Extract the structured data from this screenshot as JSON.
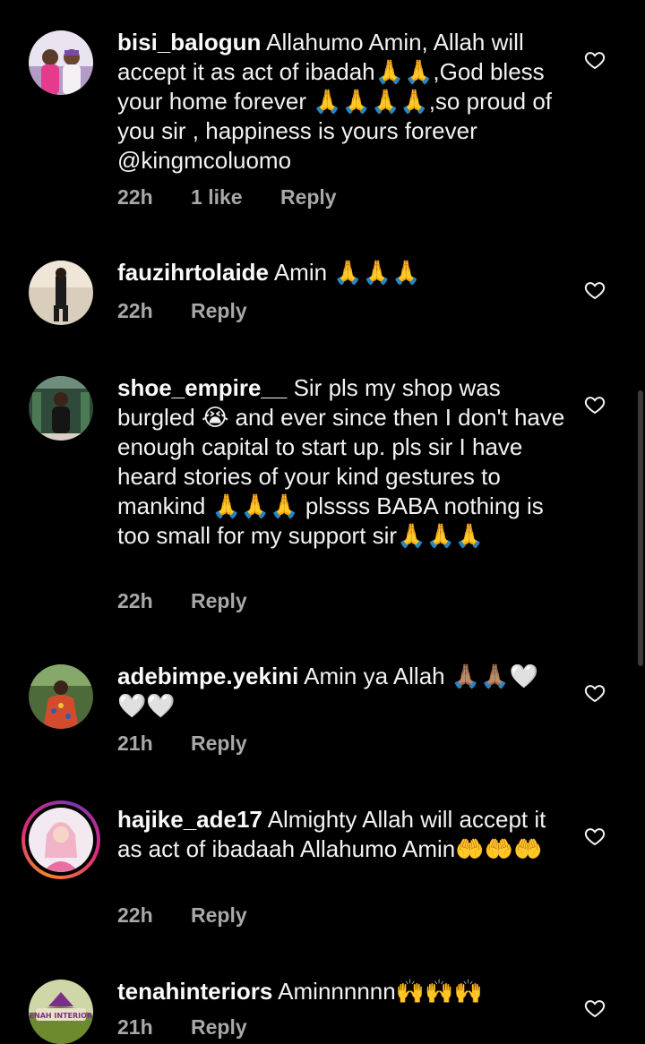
{
  "comments": [
    {
      "username": "bisi_balogun",
      "text": "Allahumo Amin, Allah will accept it as act of ibadah🙏🙏,God bless your home forever 🙏🙏🙏🙏,so proud of you sir , happiness is yours forever @kingmcoluomo",
      "time": "22h",
      "likes": "1 like",
      "reply": "Reply"
    },
    {
      "username": "fauzihrtolaide",
      "text": "Amin 🙏🙏🙏",
      "time": "22h",
      "reply": "Reply"
    },
    {
      "username": "shoe_empire__",
      "text": "Sir pls my shop was burgled 😭 and ever since then I don't have enough  capital to start up.  pls sir I have heard stories of your kind gestures to mankind 🙏🙏🙏 plssss BABA  nothing is too small for my support sir🙏🙏🙏",
      "time": "22h",
      "reply": "Reply"
    },
    {
      "username": "adebimpe.yekini",
      "text": "Amin ya Allah 🙏🏽🙏🏽🤍🤍🤍",
      "time": "21h",
      "reply": "Reply"
    },
    {
      "username": "hajike_ade17",
      "text": "Almighty Allah will accept it as act of ibadaah Allahumo Amin🤲🤲🤲",
      "time": "22h",
      "reply": "Reply"
    },
    {
      "username": "tenahinteriors",
      "text": "Aminnnnnn🙌🙌🙌",
      "time": "21h",
      "reply": "Reply",
      "avatar_text": "TENAH INTERIORS"
    }
  ],
  "icons": {
    "like": "heart-outline-icon"
  },
  "colors": {
    "background": "#000000",
    "text": "#f2f2f2",
    "meta": "#a8a8a8"
  }
}
